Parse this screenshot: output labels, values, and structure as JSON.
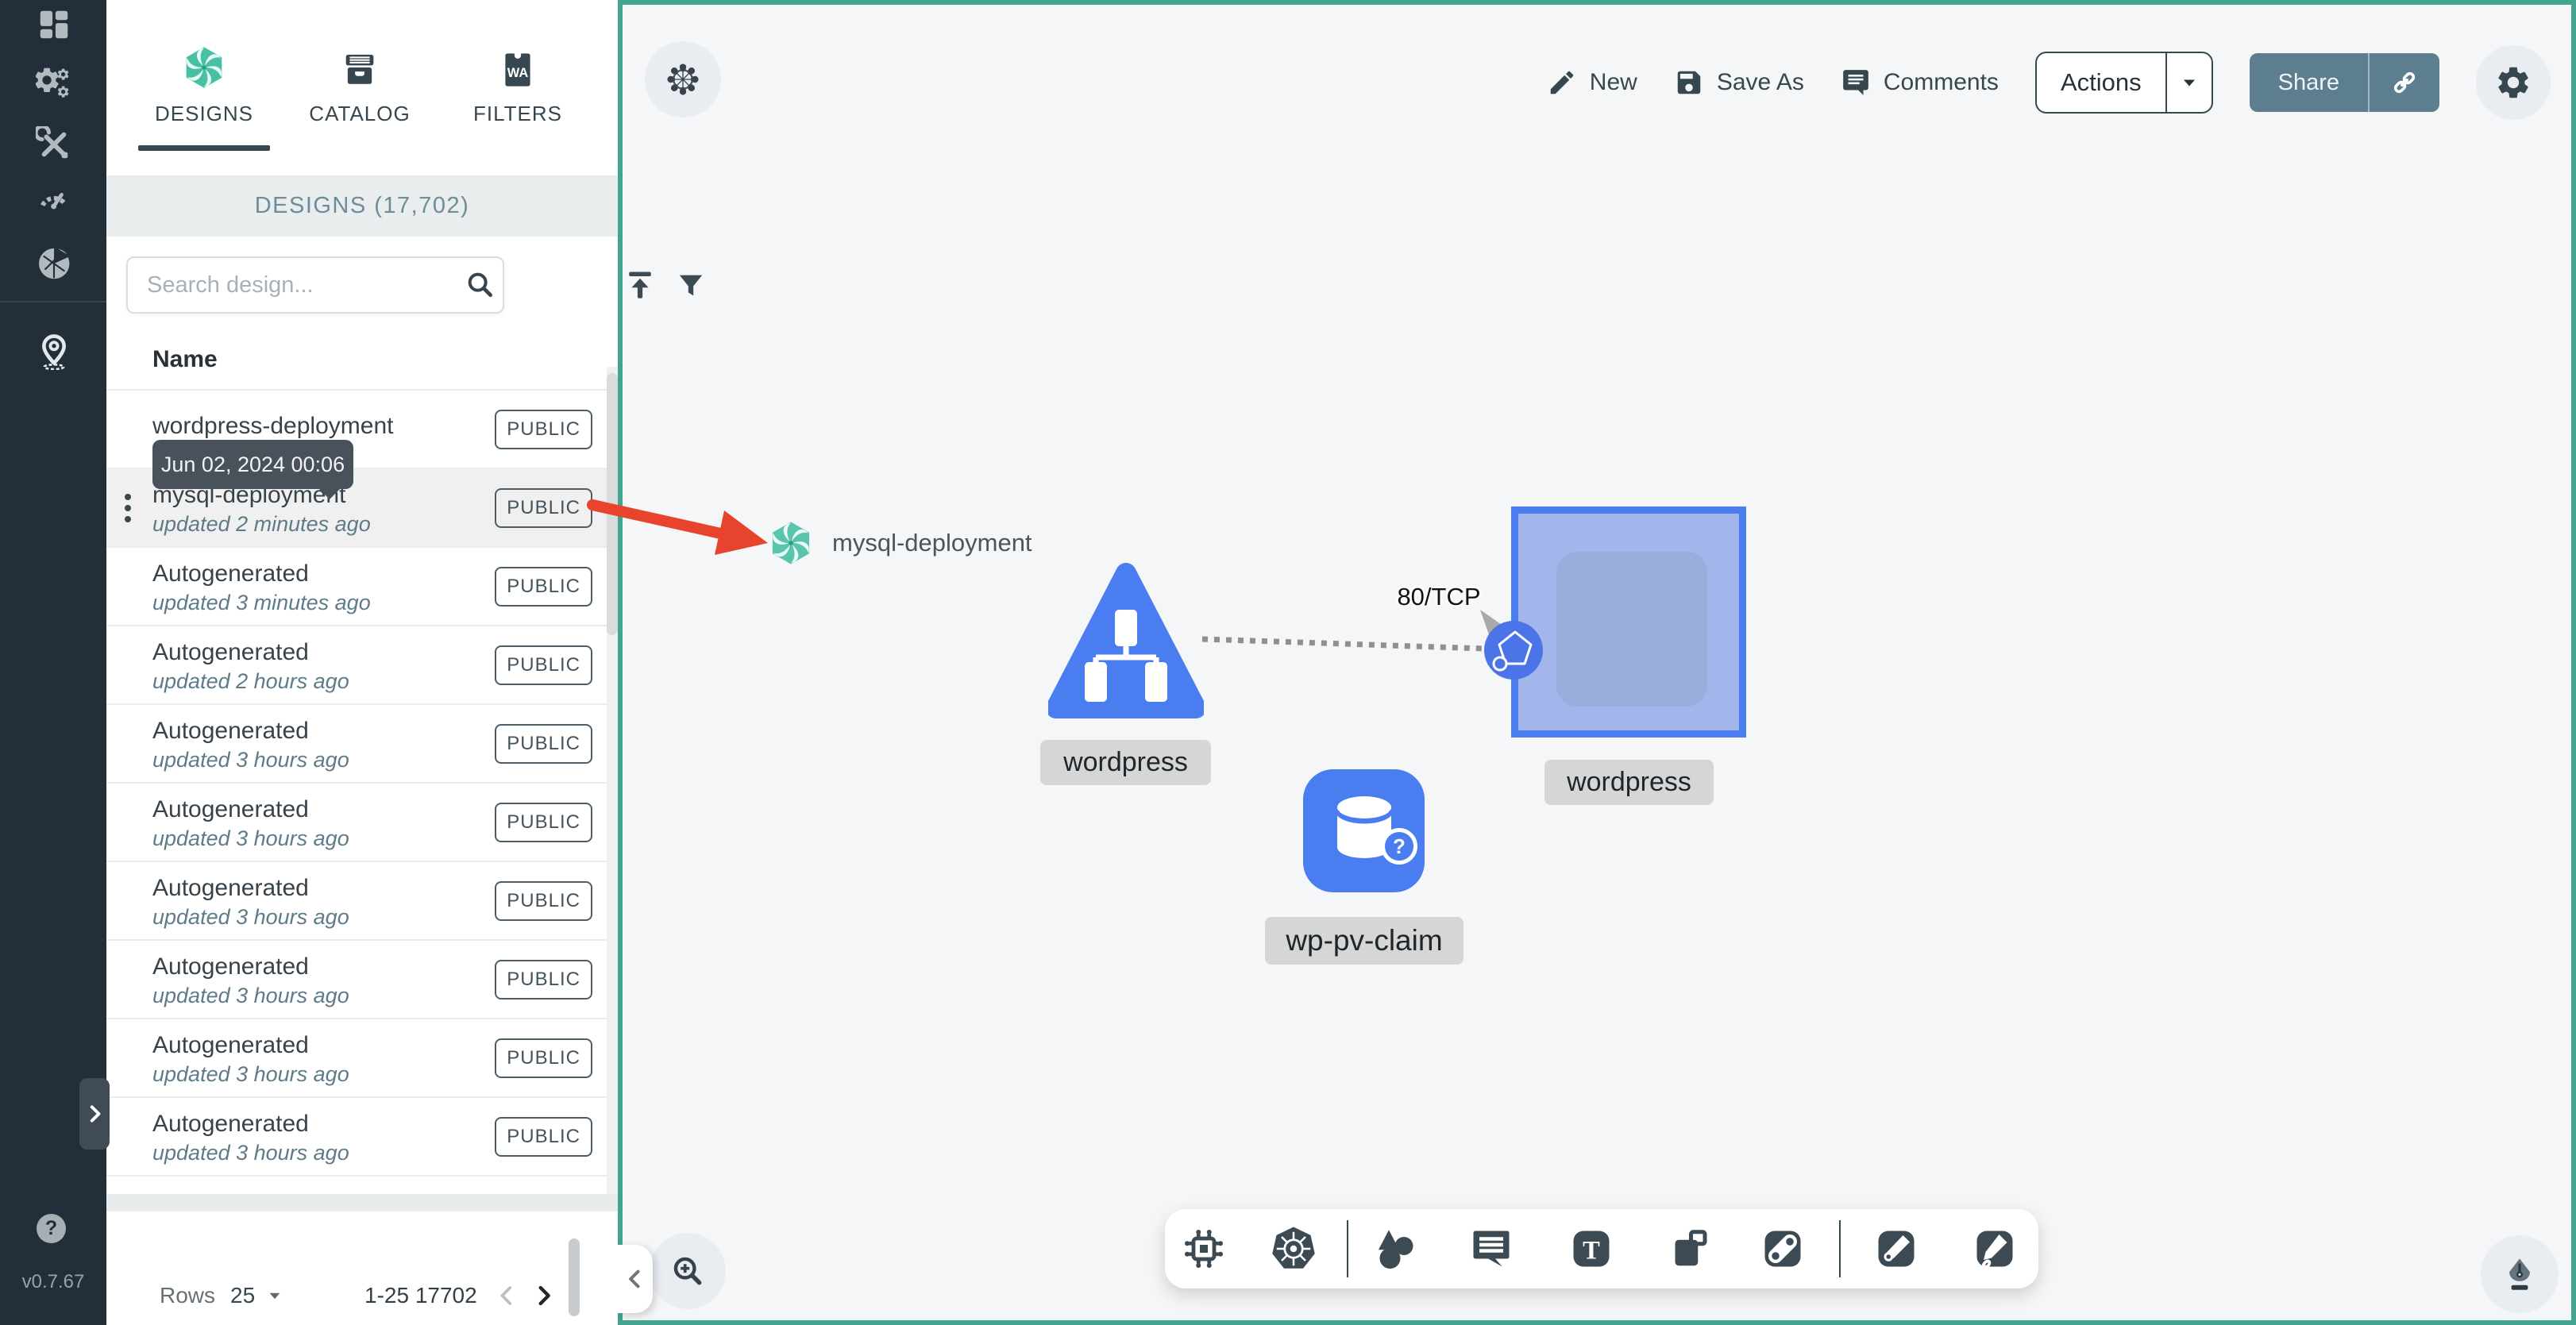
{
  "app": {
    "version": "v0.7.67",
    "help_glyph": "?"
  },
  "sidebar": {
    "tabs": [
      {
        "label": "DESIGNS"
      },
      {
        "label": "CATALOG"
      },
      {
        "label": "FILTERS",
        "icon_text": "WA"
      }
    ],
    "section_title": "DESIGNS (17,702)",
    "search_placeholder": "Search design...",
    "column_header": "Name",
    "tooltip_date": "Jun 02, 2024 00:06",
    "rows": [
      {
        "name": "wordpress-deployment",
        "updated": "",
        "visibility": "PUBLIC"
      },
      {
        "name": "mysql-deployment",
        "updated": "updated 2 minutes ago",
        "visibility": "PUBLIC"
      },
      {
        "name": "Autogenerated",
        "updated": "updated 3 minutes ago",
        "visibility": "PUBLIC"
      },
      {
        "name": "Autogenerated",
        "updated": "updated 2 hours ago",
        "visibility": "PUBLIC"
      },
      {
        "name": "Autogenerated",
        "updated": "updated 3 hours ago",
        "visibility": "PUBLIC"
      },
      {
        "name": "Autogenerated",
        "updated": "updated 3 hours ago",
        "visibility": "PUBLIC"
      },
      {
        "name": "Autogenerated",
        "updated": "updated 3 hours ago",
        "visibility": "PUBLIC"
      },
      {
        "name": "Autogenerated",
        "updated": "updated 3 hours ago",
        "visibility": "PUBLIC"
      },
      {
        "name": "Autogenerated",
        "updated": "updated 3 hours ago",
        "visibility": "PUBLIC"
      },
      {
        "name": "Autogenerated",
        "updated": "updated 3 hours ago",
        "visibility": "PUBLIC"
      }
    ],
    "pagination": {
      "rows_label": "Rows",
      "page_size": "25",
      "range": "1-25 17702"
    }
  },
  "toolbar": {
    "new_label": "New",
    "save_as_label": "Save As",
    "comments_label": "Comments",
    "actions_label": "Actions",
    "share_label": "Share"
  },
  "canvas": {
    "dragged_design_label": "mysql-deployment",
    "edge_label": "80/TCP",
    "service_node_label": "wordpress",
    "container_node_label": "wordpress",
    "pv_claim_node_label": "wp-pv-claim",
    "pv_question_glyph": "?",
    "text_tool_glyph": "T"
  },
  "colors": {
    "canvas_border": "#43A491",
    "node_blue": "#4A7DF0",
    "arrow_red": "#E8432C",
    "share_button": "#5C7E8F",
    "rail_bg": "#232E3B"
  }
}
